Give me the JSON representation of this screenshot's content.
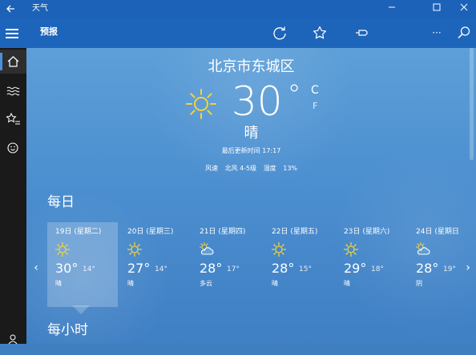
{
  "window": {
    "title": "天气"
  },
  "command_bar": {
    "page_title": "预报",
    "actions": [
      {
        "name": "refresh-icon"
      },
      {
        "name": "star-icon"
      },
      {
        "name": "pin-icon"
      },
      {
        "name": "moon-icon"
      },
      {
        "name": "more-icon",
        "glyph": "···"
      },
      {
        "name": "search-icon"
      }
    ]
  },
  "sidebar": {
    "items": [
      {
        "name": "home-icon",
        "selected": true
      },
      {
        "name": "maps-icon",
        "selected": false
      },
      {
        "name": "favorites-icon",
        "selected": false
      },
      {
        "name": "life-icon",
        "selected": false
      },
      {
        "name": "user-icon",
        "selected": false
      }
    ]
  },
  "current": {
    "location": "北京市东城区",
    "temperature": "30",
    "degree_symbol": "°",
    "unit_c": "C",
    "unit_f": "F",
    "condition": "晴",
    "condition_icon": "sun-icon",
    "updated_label": "最后更新时间",
    "updated_time": "17:17",
    "wind_label": "风速",
    "wind_value": "北风 4-5级",
    "humidity_label": "湿度",
    "humidity_value": "13%"
  },
  "daily": {
    "heading": "每日",
    "days": [
      {
        "date": "19日 (星期二)",
        "icon": "sun-icon",
        "high": "30°",
        "low": "14°",
        "condition": "晴",
        "selected": true
      },
      {
        "date": "20日 (星期三)",
        "icon": "sun-icon",
        "high": "27°",
        "low": "14°",
        "condition": "晴",
        "selected": false
      },
      {
        "date": "21日 (星期四)",
        "icon": "partly-cloudy-icon",
        "high": "28°",
        "low": "17°",
        "condition": "多云",
        "selected": false
      },
      {
        "date": "22日 (星期五)",
        "icon": "sun-icon",
        "high": "28°",
        "low": "15°",
        "condition": "晴",
        "selected": false
      },
      {
        "date": "23日 (星期六)",
        "icon": "sun-icon",
        "high": "29°",
        "low": "18°",
        "condition": "晴",
        "selected": false
      },
      {
        "date": "24日 (星期日",
        "icon": "partly-cloudy-icon",
        "high": "28°",
        "low": "19°",
        "condition": "阴",
        "selected": false
      }
    ]
  },
  "hourly": {
    "heading": "每小时"
  },
  "colors": {
    "title_bar": "#1c62b8",
    "command_bar": "#1d65bb",
    "sidebar": "#1a1a1a",
    "sun": "#f5d33a",
    "accent": "#4a90d9"
  }
}
